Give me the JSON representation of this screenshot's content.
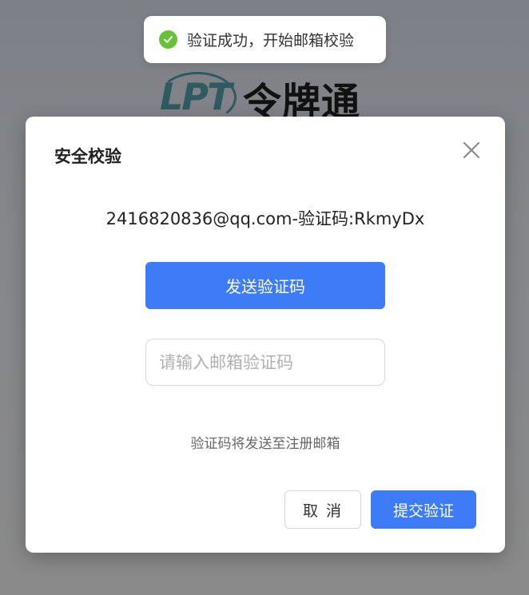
{
  "toast": {
    "message": "验证成功，开始邮箱校验",
    "icon": "check-circle-icon",
    "color": "#67c23a"
  },
  "brand": {
    "logo_mark": "LPT",
    "name": "令牌通"
  },
  "dialog": {
    "title": "安全校验",
    "email_line": "2416820836@qq.com-验证码:RkmyDx",
    "send_button": "发送验证码",
    "code_input": {
      "placeholder": "请输入邮箱验证码",
      "value": ""
    },
    "hint": "验证码将发送至注册邮箱",
    "cancel_button": "取 消",
    "submit_button": "提交验证",
    "close_icon": "close-icon"
  },
  "colors": {
    "primary": "#3e7bf7",
    "success": "#67c23a"
  }
}
